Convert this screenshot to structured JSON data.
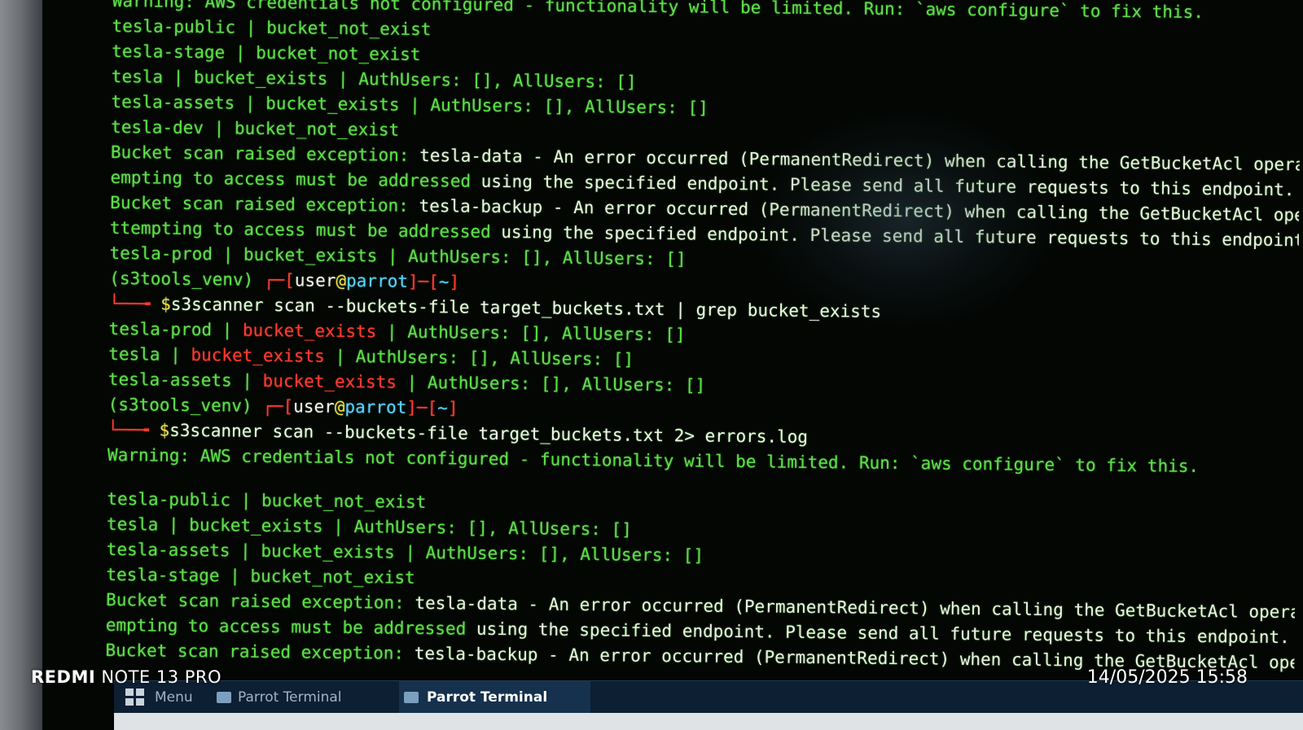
{
  "terminal": {
    "lines": [
      {
        "t": "plain",
        "text": "Warning: AWS credentials not configured - functionality will be limited. Run: `aws configure` to fix this."
      },
      {
        "t": "plain",
        "text": "tesla-public | bucket_not_exist"
      },
      {
        "t": "plain",
        "text": "tesla-stage | bucket_not_exist"
      },
      {
        "t": "plain",
        "text": "tesla | bucket_exists | AuthUsers: [], AllUsers: []"
      },
      {
        "t": "plain",
        "text": "tesla-assets | bucket_exists | AuthUsers: [], AllUsers: []"
      },
      {
        "t": "plain",
        "text": "tesla-dev | bucket_not_exist"
      },
      {
        "t": "err",
        "pre": "Bucket scan raised exception: ",
        "rest": "tesla-data - An error occurred (PermanentRedirect) when calling the GetBucketAcl operati"
      },
      {
        "t": "err",
        "pre": "empting to access must be addressed ",
        "rest": "using the specified endpoint. Please send all future requests to this endpoint."
      },
      {
        "t": "err",
        "pre": "Bucket scan raised exception: ",
        "rest": "tesla-backup - An error occurred (PermanentRedirect) when calling the GetBucketAcl opera"
      },
      {
        "t": "err",
        "pre": "ttempting to access must be addressed ",
        "rest": "using the specified endpoint. Please send all future requests to this endpoint."
      },
      {
        "t": "plain",
        "text": "tesla-prod | bucket_exists | AuthUsers: [], AllUsers: []"
      },
      {
        "t": "prompt",
        "venv": "(s3tools_venv) ",
        "b1": "┌─[",
        "user": "user",
        "at": "@",
        "host": "parrot",
        "b2": "]─[",
        "dir": "~",
        "b3": "]"
      },
      {
        "t": "cmd",
        "corner": "└──╼ ",
        "dollar": "$",
        "text": "s3scanner scan --buckets-file target_buckets.txt | grep bucket_exists"
      },
      {
        "t": "match",
        "a": "tesla-prod | ",
        "m": "bucket_exists",
        "b": " | AuthUsers: [], AllUsers: []"
      },
      {
        "t": "match",
        "a": "tesla | ",
        "m": "bucket_exists",
        "b": " | AuthUsers: [], AllUsers: []"
      },
      {
        "t": "match",
        "a": "tesla-assets | ",
        "m": "bucket_exists",
        "b": " | AuthUsers: [], AllUsers: []"
      },
      {
        "t": "prompt",
        "venv": "(s3tools_venv) ",
        "b1": "┌─[",
        "user": "user",
        "at": "@",
        "host": "parrot",
        "b2": "]─[",
        "dir": "~",
        "b3": "]"
      },
      {
        "t": "cmd",
        "corner": "└──╼ ",
        "dollar": "$",
        "text": "s3scanner scan --buckets-file target_buckets.txt 2> errors.log"
      },
      {
        "t": "plain",
        "text": "Warning: AWS credentials not configured - functionality will be limited. Run: `aws configure` to fix this."
      },
      {
        "t": "blank",
        "text": ""
      },
      {
        "t": "plain",
        "text": "tesla-public | bucket_not_exist"
      },
      {
        "t": "plain",
        "text": "tesla | bucket_exists | AuthUsers: [], AllUsers: []"
      },
      {
        "t": "plain",
        "text": "tesla-assets | bucket_exists | AuthUsers: [], AllUsers: []"
      },
      {
        "t": "plain",
        "text": "tesla-stage | bucket_not_exist"
      },
      {
        "t": "err",
        "pre": "Bucket scan raised exception: ",
        "rest": "tesla-data - An error occurred (PermanentRedirect) when calling the GetBucketAcl operation"
      },
      {
        "t": "err",
        "pre": "empting to access must be addressed ",
        "rest": "using the specified endpoint. Please send all future requests to this endpoint."
      },
      {
        "t": "err",
        "pre": "Bucket scan raised exception: ",
        "rest": "tesla-backup - An error occurred (PermanentRedirect) when calling the GetBucketAcl operati"
      }
    ]
  },
  "taskbar": {
    "menu_label": "Menu",
    "task1_label": "Parrot Terminal",
    "task2_label": "Parrot Terminal"
  },
  "overlay": {
    "brand": "REDMI",
    "model": " NOTE 13 PRO",
    "timestamp": "14/05/2025 15:58"
  },
  "colors": {
    "terminal_green": "#5fe04a",
    "match_red": "#ff3b2f",
    "host_cyan": "#58d6ff",
    "taskbar_bg": "#0c1f33"
  }
}
